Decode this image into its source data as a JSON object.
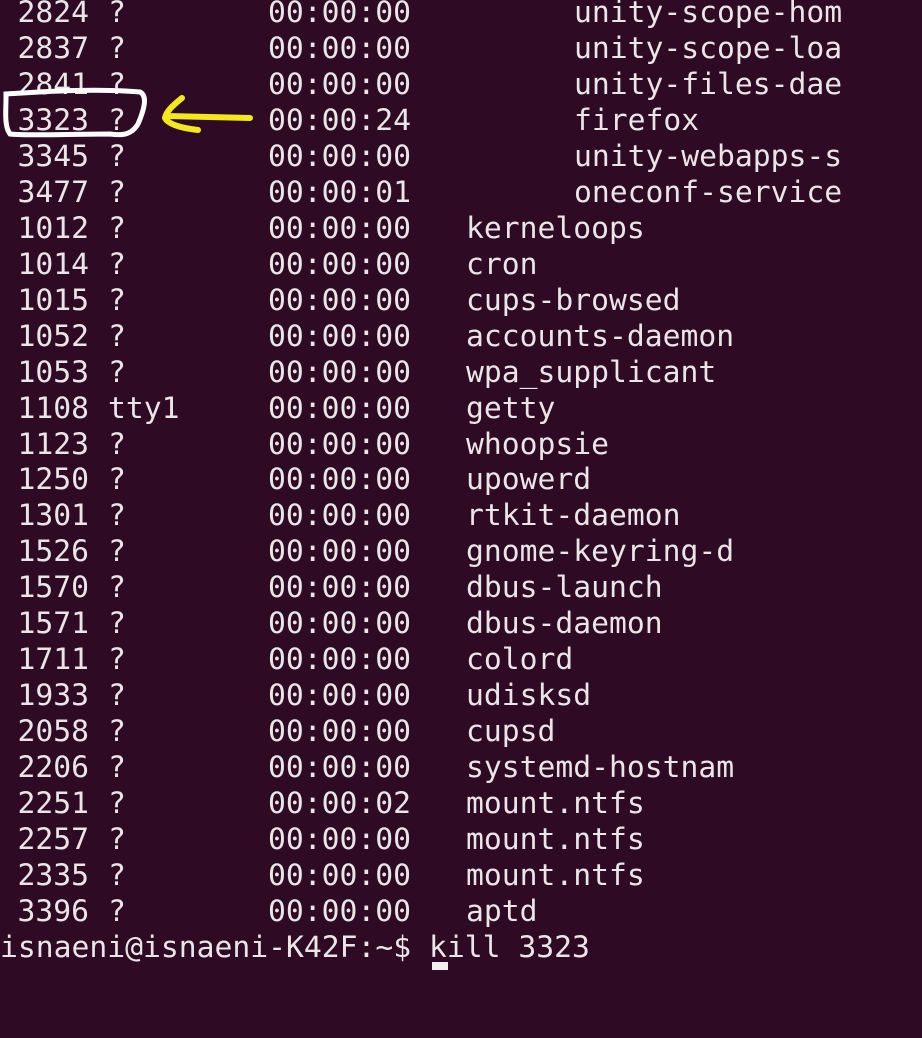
{
  "terminal": {
    "rows": [
      {
        "pid": "2824",
        "tty": "?",
        "time": "00:00:00",
        "cmd": "unity-scope-hom",
        "indent": true
      },
      {
        "pid": "2837",
        "tty": "?",
        "time": "00:00:00",
        "cmd": "unity-scope-loa",
        "indent": true
      },
      {
        "pid": "2841",
        "tty": "?",
        "time": "00:00:00",
        "cmd": "unity-files-dae",
        "indent": true
      },
      {
        "pid": "3323",
        "tty": "?",
        "time": "00:00:24",
        "cmd": "firefox",
        "indent": true
      },
      {
        "pid": "3345",
        "tty": "?",
        "time": "00:00:00",
        "cmd": "unity-webapps-s",
        "indent": true
      },
      {
        "pid": "3477",
        "tty": "?",
        "time": "00:00:01",
        "cmd": "oneconf-service",
        "indent": true
      },
      {
        "pid": "1012",
        "tty": "?",
        "time": "00:00:00",
        "cmd": "kerneloops",
        "indent": false
      },
      {
        "pid": "1014",
        "tty": "?",
        "time": "00:00:00",
        "cmd": "cron",
        "indent": false
      },
      {
        "pid": "1015",
        "tty": "?",
        "time": "00:00:00",
        "cmd": "cups-browsed",
        "indent": false
      },
      {
        "pid": "1052",
        "tty": "?",
        "time": "00:00:00",
        "cmd": "accounts-daemon",
        "indent": false
      },
      {
        "pid": "1053",
        "tty": "?",
        "time": "00:00:00",
        "cmd": "wpa_supplicant",
        "indent": false
      },
      {
        "pid": "1108",
        "tty": "tty1",
        "time": "00:00:00",
        "cmd": "getty",
        "indent": false
      },
      {
        "pid": "1123",
        "tty": "?",
        "time": "00:00:00",
        "cmd": "whoopsie",
        "indent": false
      },
      {
        "pid": "1250",
        "tty": "?",
        "time": "00:00:00",
        "cmd": "upowerd",
        "indent": false
      },
      {
        "pid": "1301",
        "tty": "?",
        "time": "00:00:00",
        "cmd": "rtkit-daemon",
        "indent": false
      },
      {
        "pid": "1526",
        "tty": "?",
        "time": "00:00:00",
        "cmd": "gnome-keyring-d",
        "indent": false
      },
      {
        "pid": "1570",
        "tty": "?",
        "time": "00:00:00",
        "cmd": "dbus-launch",
        "indent": false
      },
      {
        "pid": "1571",
        "tty": "?",
        "time": "00:00:00",
        "cmd": "dbus-daemon",
        "indent": false
      },
      {
        "pid": "1711",
        "tty": "?",
        "time": "00:00:00",
        "cmd": "colord",
        "indent": false
      },
      {
        "pid": "1933",
        "tty": "?",
        "time": "00:00:00",
        "cmd": "udisksd",
        "indent": false
      },
      {
        "pid": "2058",
        "tty": "?",
        "time": "00:00:00",
        "cmd": "cupsd",
        "indent": false
      },
      {
        "pid": "2206",
        "tty": "?",
        "time": "00:00:00",
        "cmd": "systemd-hostnam",
        "indent": false
      },
      {
        "pid": "2251",
        "tty": "?",
        "time": "00:00:02",
        "cmd": "mount.ntfs",
        "indent": false
      },
      {
        "pid": "2257",
        "tty": "?",
        "time": "00:00:00",
        "cmd": "mount.ntfs",
        "indent": false
      },
      {
        "pid": "2335",
        "tty": "?",
        "time": "00:00:00",
        "cmd": "mount.ntfs",
        "indent": false
      },
      {
        "pid": "3396",
        "tty": "?",
        "time": "00:00:00",
        "cmd": "aptd",
        "indent": false
      }
    ],
    "prompt": "isnaeni@isnaeni-K42F:~$ kill 3323",
    "highlighted_pid": "3323"
  },
  "colors": {
    "background": "#2f0a25",
    "text": "#e8e6e6",
    "circle_annotation": "#ffffff",
    "arrow_annotation": "#f2e81c"
  }
}
